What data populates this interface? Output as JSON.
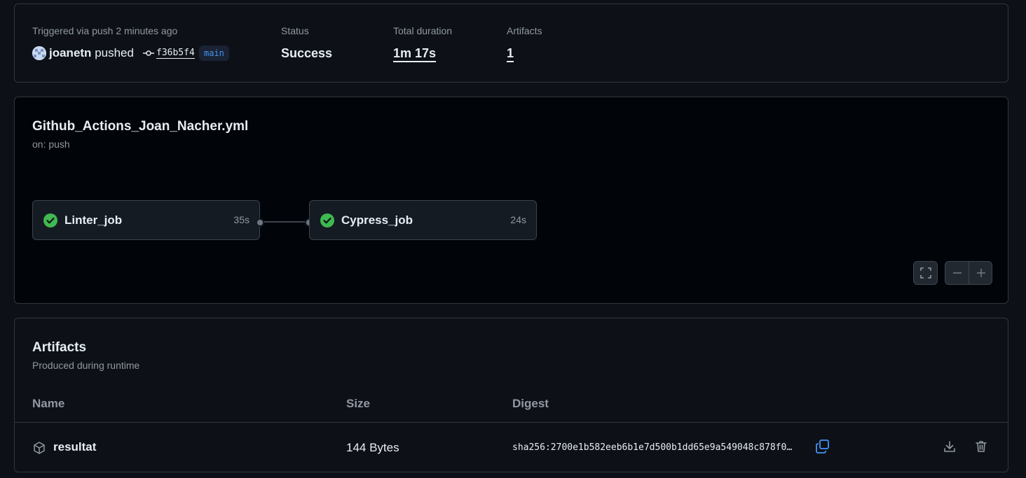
{
  "summary": {
    "trigger_label": "Triggered via push 2 minutes ago",
    "actor": "joanetn",
    "action": "pushed",
    "commit_sha": "f36b5f4",
    "branch": "main",
    "status_label": "Status",
    "status_value": "Success",
    "duration_label": "Total duration",
    "duration_value": "1m 17s",
    "artifacts_label": "Artifacts",
    "artifacts_value": "1"
  },
  "workflow": {
    "title": "Github_Actions_Joan_Nacher.yml",
    "trigger": "on: push",
    "jobs": [
      {
        "name": "Linter_job",
        "duration": "35s",
        "status": "success"
      },
      {
        "name": "Cypress_job",
        "duration": "24s",
        "status": "success"
      }
    ]
  },
  "artifacts": {
    "title": "Artifacts",
    "subtitle": "Produced during runtime",
    "columns": [
      "Name",
      "Size",
      "Digest"
    ],
    "rows": [
      {
        "name": "resultat",
        "size": "144 Bytes",
        "digest": "sha256:2700e1b582eeb6b1e7d500b1dd65e9a549048c878f0…"
      }
    ]
  },
  "colors": {
    "success": "#3fb950",
    "accent": "#4493f8",
    "background": "#0d1117"
  }
}
